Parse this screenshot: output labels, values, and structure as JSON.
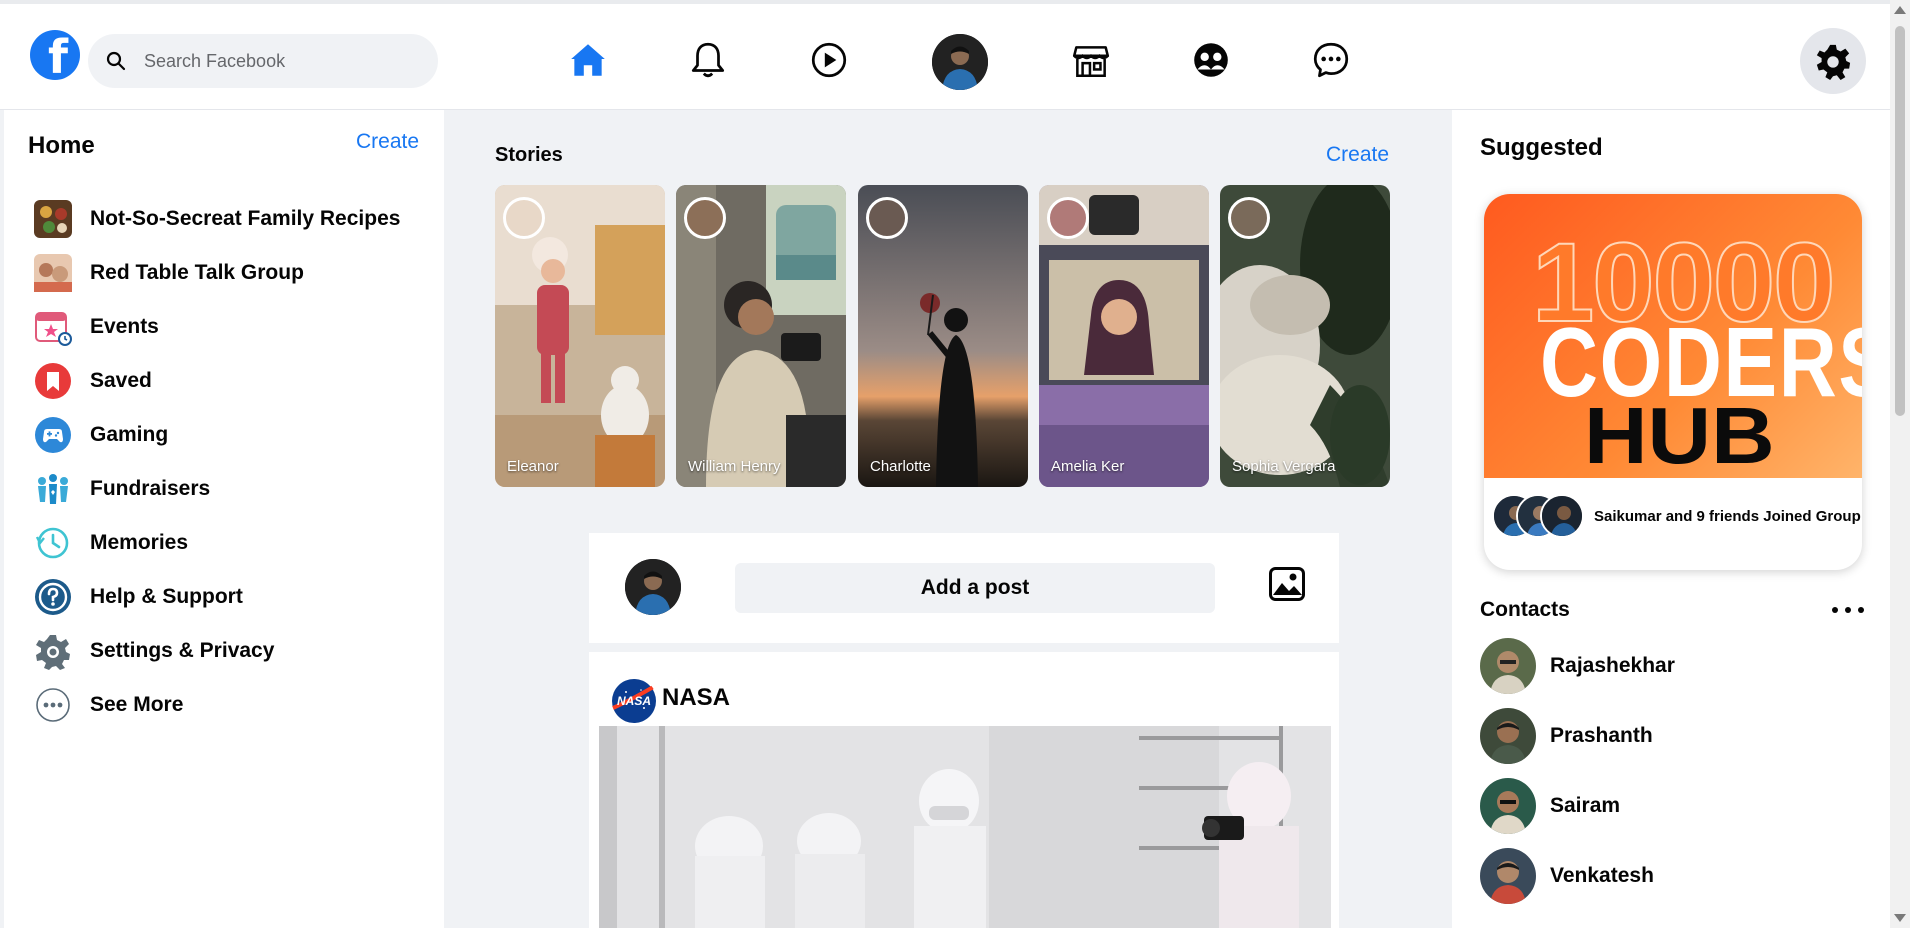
{
  "header": {
    "search_placeholder": "Search Facebook",
    "nav_icons": [
      "home-icon",
      "bell-icon",
      "play-icon",
      "profile-avatar",
      "marketplace-icon",
      "groups-icon",
      "messenger-icon"
    ],
    "active_color": "#1877f2"
  },
  "left": {
    "title": "Home",
    "create": "Create",
    "items": [
      {
        "label": "Not-So-Secreat Family Recipes",
        "icon": "group-photo"
      },
      {
        "label": "Red Table Talk Group",
        "icon": "group-photo"
      },
      {
        "label": "Events",
        "icon": "calendar-icon"
      },
      {
        "label": "Saved",
        "icon": "bookmark-icon"
      },
      {
        "label": "Gaming",
        "icon": "gamepad-icon"
      },
      {
        "label": "Fundraisers",
        "icon": "hands-icon"
      },
      {
        "label": "Memories",
        "icon": "clock-icon"
      },
      {
        "label": "Help & Support",
        "icon": "question-icon"
      },
      {
        "label": "Settings & Privacy",
        "icon": "gear-icon"
      },
      {
        "label": "See More",
        "icon": "more-icon"
      }
    ]
  },
  "stories": {
    "title": "Stories",
    "create": "Create",
    "items": [
      {
        "name": "Eleanor"
      },
      {
        "name": "William Henry"
      },
      {
        "name": "Charlotte"
      },
      {
        "name": "Amelia Ker"
      },
      {
        "name": "Sophia Vergara"
      }
    ]
  },
  "composer": {
    "add_post": "Add a post"
  },
  "post": {
    "author": "NASA"
  },
  "right": {
    "suggested_title": "Suggested",
    "card": {
      "line1": "10000",
      "line2": "CODERS",
      "line3": "HUB",
      "footer": "Saikumar and 9 friends Joined Group"
    },
    "contacts_title": "Contacts",
    "contacts": [
      {
        "name": "Rajashekhar"
      },
      {
        "name": "Prashanth"
      },
      {
        "name": "Sairam"
      },
      {
        "name": "Venkatesh"
      }
    ]
  }
}
